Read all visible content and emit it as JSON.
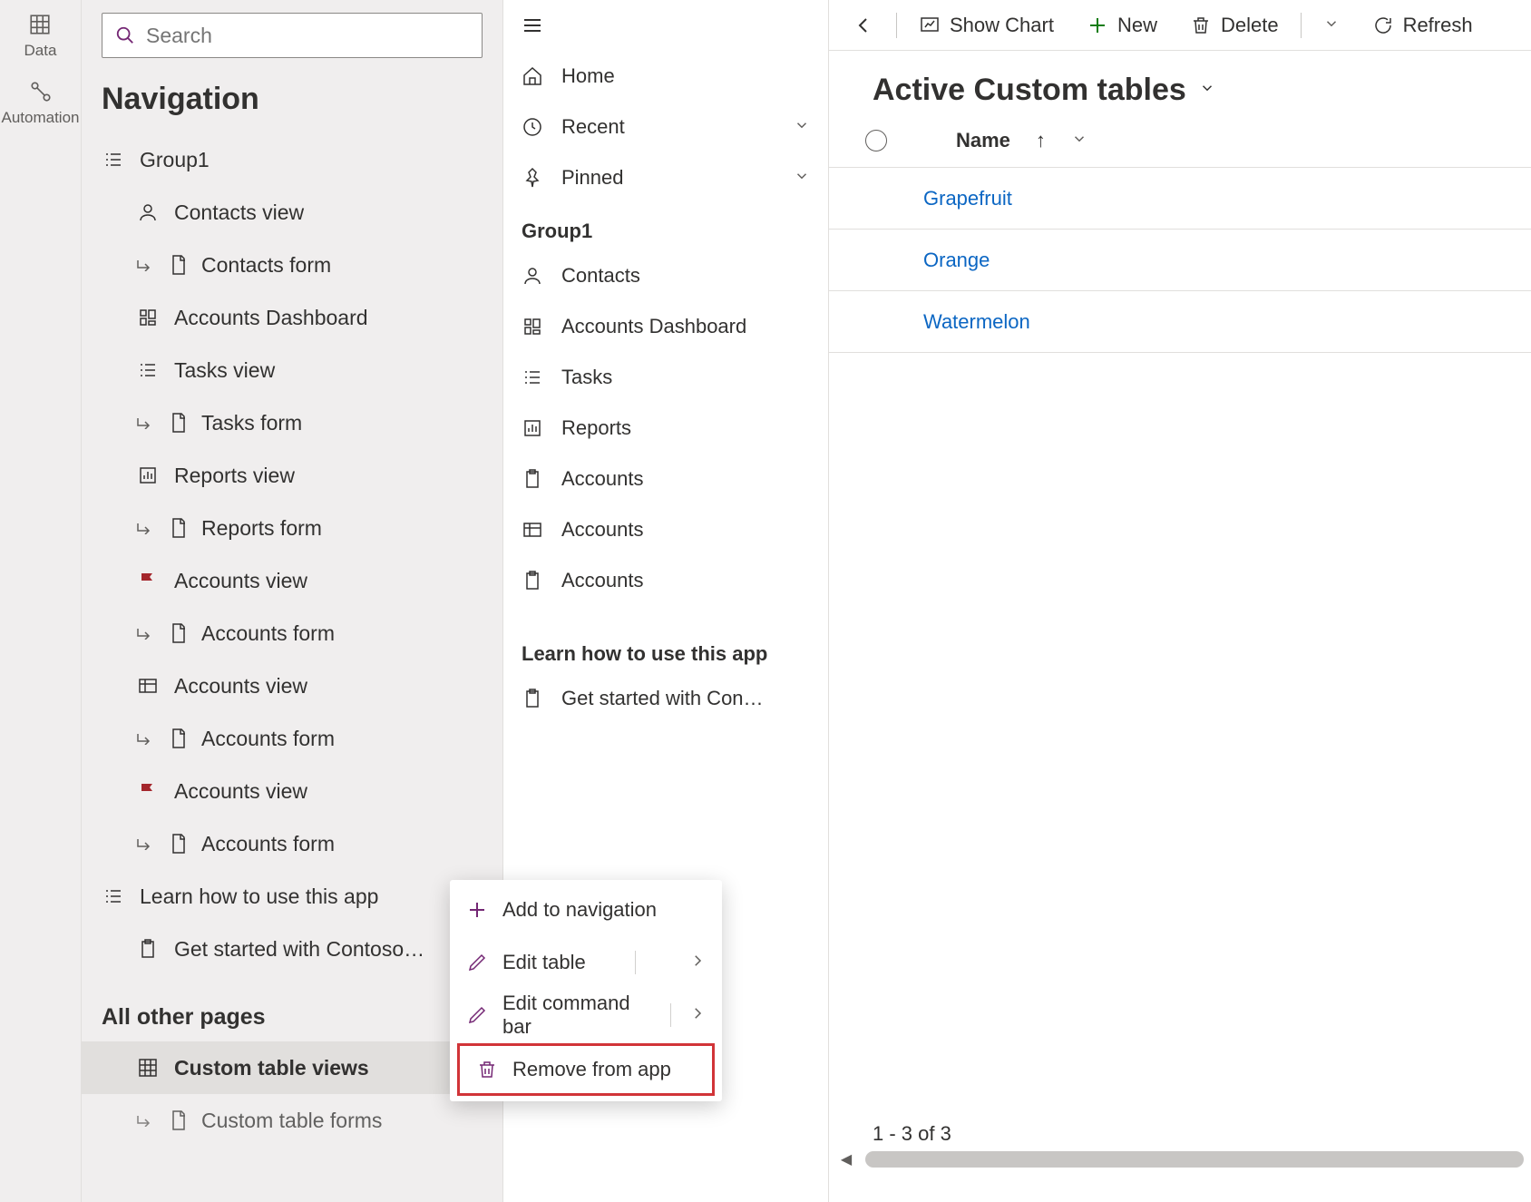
{
  "rail": {
    "data_label": "Data",
    "automation_label": "Automation"
  },
  "search": {
    "placeholder": "Search"
  },
  "nav": {
    "title": "Navigation",
    "group1_label": "Group1",
    "items": [
      {
        "label": "Contacts view"
      },
      {
        "label": "Contacts form"
      },
      {
        "label": "Accounts Dashboard"
      },
      {
        "label": "Tasks view"
      },
      {
        "label": "Tasks form"
      },
      {
        "label": "Reports view"
      },
      {
        "label": "Reports form"
      },
      {
        "label": "Accounts view"
      },
      {
        "label": "Accounts form"
      },
      {
        "label": "Accounts view"
      },
      {
        "label": "Accounts form"
      },
      {
        "label": "Accounts view"
      },
      {
        "label": "Accounts form"
      }
    ],
    "learn_label": "Learn how to use this app",
    "getstarted_label": "Get started with Contoso…",
    "other_pages_title": "All other pages",
    "other_pages": [
      {
        "label": "Custom table views"
      },
      {
        "label": "Custom table forms"
      }
    ]
  },
  "sitemap": {
    "home": "Home",
    "recent": "Recent",
    "pinned": "Pinned",
    "group1": "Group1",
    "items": [
      "Contacts",
      "Accounts Dashboard",
      "Tasks",
      "Reports",
      "Accounts",
      "Accounts",
      "Accounts"
    ],
    "learn_header": "Learn how to use this app",
    "getstarted": "Get started with Con…"
  },
  "commands": {
    "show_chart": "Show Chart",
    "new": "New",
    "delete": "Delete",
    "refresh": "Refresh"
  },
  "view": {
    "title": "Active Custom tables",
    "column_name": "Name",
    "rows": [
      "Grapefruit",
      "Orange",
      "Watermelon"
    ],
    "count_label": "1 - 3 of 3"
  },
  "context_menu": {
    "add_to_nav": "Add to navigation",
    "edit_table": "Edit table",
    "edit_cmdbar": "Edit command bar",
    "remove": "Remove from app"
  }
}
